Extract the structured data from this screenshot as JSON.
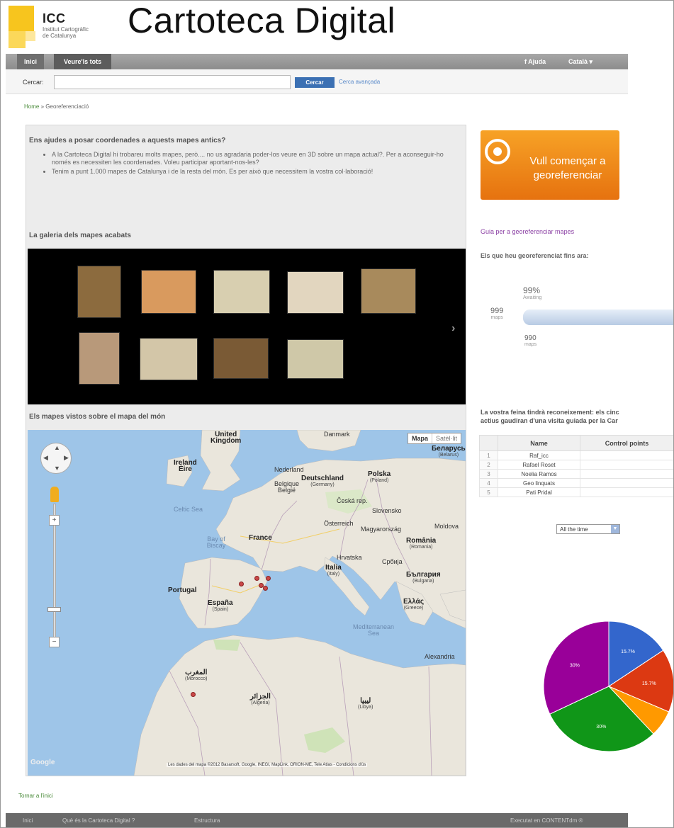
{
  "header": {
    "logo_name": "ICC",
    "logo_sub": "Institut Cartogràfic de Catalunya",
    "site_title": "Cartoteca Digital"
  },
  "nav": {
    "inici": "Inici",
    "veure": "Veure'ls tots",
    "right1": "f Ajuda",
    "right2": "Català ▾"
  },
  "search": {
    "label": "Cercar:",
    "value": "",
    "button": "Cercar",
    "advanced": "Cerca avançada"
  },
  "breadcrumb": {
    "home": "Home",
    "sep": "»",
    "current": "Georeferenciació"
  },
  "intro": {
    "title": "Ens ajudes a posar coordenades a aquests mapes antics?",
    "bullet1": "A la Cartoteca Digital hi trobareu molts mapes, però.... no us agradaria poder-los veure en 3D sobre un mapa actual?. Per a aconseguir-ho només es necessiten les coordenades. Voleu participar aportant-nos-les?",
    "bullet2": "Tenim a punt 1.000 mapes de Catalunya i de la resta del món. Es per això que necessitem la vostra col·laboració!"
  },
  "gallery": {
    "title": "La galeria dels mapes acabats",
    "next": "›",
    "thumb_colors": [
      "#8c6b3e",
      "#d99a5e",
      "#d8cfb0",
      "#e2d6bf",
      "#a88a5c",
      "#b8997a",
      "#d3c6a8",
      "#7a5a35",
      "#cfc8a8"
    ]
  },
  "worldmap": {
    "title": "Els mapes vistos sobre el mapa del món",
    "type_map": "Mapa",
    "type_sat": "Satèl·lit",
    "google": "Google",
    "attribution": "Les dades del mapa ©2012 Basarsoft, Google, INEGI, MapLink, ORION-ME, Tele Atlas - Condicions d'ús",
    "labels": {
      "uk": "United",
      "uk2": "Kingdom",
      "ireland": "Ireland",
      "ireland2": "Éire",
      "denmark": "Danmark",
      "netherlands": "Nederland",
      "belgium": "Belgique",
      "belgium2": "België",
      "germany": "Deutschland",
      "germany_sub": "(Germany)",
      "poland": "Polska",
      "poland_sub": "(Poland)",
      "belarus": "Беларусь",
      "belarus_sub": "(Belarus)",
      "czech": "Česká rep.",
      "austria": "Österreich",
      "hungary": "Magyarország",
      "slovakia": "Slovensko",
      "moldova": "Moldova",
      "france": "France",
      "romania": "România",
      "romania_sub": "(Romania)",
      "italy": "Italia",
      "italy_sub": "(Italy)",
      "croatia": "Hrvatska",
      "serbia": "Србија",
      "bulgaria": "България",
      "bulgaria_sub": "(Bulgaria)",
      "portugal": "Portugal",
      "spain": "España",
      "spain_sub": "(Spain)",
      "greece": "Ελλάς",
      "greece_sub": "(Greece)",
      "morocco": "المغرب",
      "morocco_sub": "(Morocco)",
      "algeria": "الجزائر",
      "algeria_sub": "(Algeria)",
      "libya": "ليبيا",
      "libya_sub": "(Libya)",
      "bay": "Bay of Biscay",
      "celtic": "Celtic Sea",
      "med": "Mediterranean Sea",
      "alexandria": "Alexandria"
    }
  },
  "sidebar": {
    "cta": "Vull començar a georeferenciar",
    "guide": "Guia per a georeferenciar mapes",
    "stats_title": "Els que heu georeferenciat fins ara:",
    "total_value": "999",
    "total_unit": "maps",
    "pct_value": "99%",
    "pct_unit": "Awaiting",
    "done_value": "990",
    "done_unit": "maps",
    "reward_line1": "La vostra feina tindrà reconeixement: els cinc",
    "reward_line2": "actius gaudiran d'una visita guiada per la Car"
  },
  "ranking": {
    "col_name": "Name",
    "col_points": "Control points",
    "rows": [
      {
        "idx": "1",
        "name": "Raf_icc"
      },
      {
        "idx": "2",
        "name": "Rafael Roset"
      },
      {
        "idx": "3",
        "name": "Noelia Ramos"
      },
      {
        "idx": "4",
        "name": "Geo linquats"
      },
      {
        "idx": "5",
        "name": "Pati Pridal"
      }
    ],
    "period": "All the time"
  },
  "chart_data": {
    "type": "pie",
    "slices": [
      {
        "label": "15.7%",
        "value": 15.7,
        "color": "#3366cc"
      },
      {
        "label": "15.7%",
        "value": 15.7,
        "color": "#dc3912"
      },
      {
        "label": "",
        "value": 6.6,
        "color": "#ff9900"
      },
      {
        "label": "30%",
        "value": 30,
        "color": "#109618"
      },
      {
        "label": "30%",
        "value": 32,
        "color": "#990099"
      }
    ]
  },
  "footer": {
    "link1": "Inici",
    "link2": "Què és la Cartoteca Digital ?",
    "link3": "Estructura",
    "right": "Executat en CONTENTdm ®"
  },
  "back_link": "Tornar a l'inici"
}
